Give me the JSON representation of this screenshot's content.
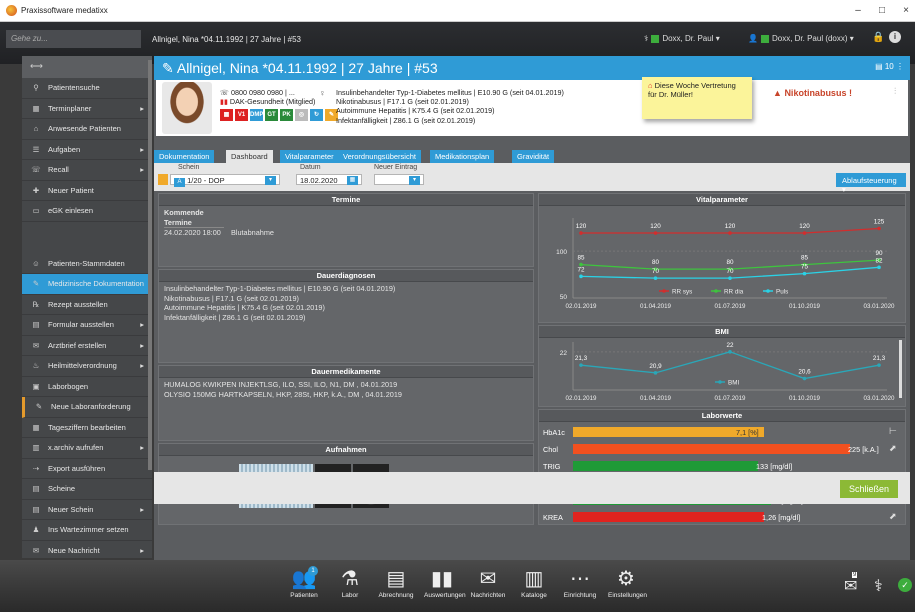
{
  "window": {
    "title": "Praxissoftware medatixx",
    "min": "–",
    "max": "□",
    "close": "×"
  },
  "topbar": {
    "search_placeholder": "Gehe zu...",
    "patient": "Allnigel, Nina *04.11.1992 | 27 Jahre | #53",
    "doctor1": "Doxx, Dr. Paul",
    "doctor2": "Doxx, Dr. Paul (doxx)"
  },
  "sidebar": {
    "items": [
      {
        "label": "Patientensuche",
        "icon": "search-user-icon",
        "arrow": false
      },
      {
        "label": "Terminplaner",
        "icon": "calendar-icon",
        "arrow": true
      },
      {
        "label": "Anwesende Patienten",
        "icon": "building-icon",
        "arrow": false
      },
      {
        "label": "Aufgaben",
        "icon": "checklist-icon",
        "arrow": true
      },
      {
        "label": "Recall",
        "icon": "recall-icon",
        "arrow": true
      },
      {
        "label": "Neuer Patient",
        "icon": "add-user-icon",
        "arrow": false
      },
      {
        "label": "eGK einlesen",
        "icon": "card-icon",
        "arrow": false
      },
      {
        "label": "Patienten-Stammdaten",
        "icon": "user-icon",
        "arrow": false
      },
      {
        "label": "Medizinische Dokumentation",
        "icon": "doc-edit-icon",
        "arrow": false
      },
      {
        "label": "Rezept ausstellen",
        "icon": "prescription-icon",
        "arrow": false
      },
      {
        "label": "Formular ausstellen",
        "icon": "form-icon",
        "arrow": true
      },
      {
        "label": "Arztbrief erstellen",
        "icon": "letter-icon",
        "arrow": true
      },
      {
        "label": "Heilmittelverordnung",
        "icon": "therapy-icon",
        "arrow": true
      },
      {
        "label": "Laborbogen",
        "icon": "lab-sheet-icon",
        "arrow": false
      },
      {
        "label": "Neue Laboranforderung",
        "icon": "lab-request-icon",
        "arrow": false
      },
      {
        "label": "Tagesziffern bearbeiten",
        "icon": "calendar-edit-icon",
        "arrow": false
      },
      {
        "label": "x.archiv aufrufen",
        "icon": "archive-icon",
        "arrow": true
      },
      {
        "label": "Export ausführen",
        "icon": "export-icon",
        "arrow": false
      },
      {
        "label": "Scheine",
        "icon": "scheine-icon",
        "arrow": false
      },
      {
        "label": "Neuer Schein",
        "icon": "new-schein-icon",
        "arrow": true
      },
      {
        "label": "Ins Wartezimmer setzen",
        "icon": "waiting-room-icon",
        "arrow": false
      },
      {
        "label": "Neue Nachricht",
        "icon": "message-icon",
        "arrow": true
      }
    ]
  },
  "header": {
    "title": "Allnigel, Nina *04.11.1992 | 27 Jahre | #53",
    "right_badge": "10"
  },
  "patient": {
    "phone": "0800 0980 0980 | ...",
    "insurance": "DAK-Gesundheit (Mitglied)",
    "badges": [
      "V1",
      "DMP",
      "GT",
      "PK"
    ],
    "diagnoses": [
      "Insulinbehandelter Typ-1-Diabetes mellitus | E10.90 G (seit 04.01.2019)",
      "Nikotinabusus | F17.1 G (seit 02.01.2019)",
      "Autoimmune Hepatitis | K75.4 G (seit 02.01.2019)",
      "Infektanfälligkeit | Z86.1 G (seit 02.01.2019)"
    ],
    "note": "Diese Woche Vertretung für Dr. Müller!",
    "alert": "Nikotinabusus !"
  },
  "tabs": [
    "Dokumentation",
    "Dashboard",
    "Vitalparameter",
    "Verordnungsübersicht",
    "Medikationsplan",
    "Gravidität"
  ],
  "active_tab": "Dashboard",
  "filters": {
    "schein_label": "Schein",
    "schein_value": "1/20 - DOP",
    "datum_label": "Datum",
    "datum_value": "18.02.2020",
    "eintrag_label": "Neuer Eintrag",
    "ablauf_label": "Ablaufsteuerung"
  },
  "termine": {
    "title": "Termine",
    "sub": "Kommende Termine",
    "date": "24.02.2020 18:00",
    "desc": "Blutabnahme"
  },
  "dauerdiagnosen": {
    "title": "Dauerdiagnosen",
    "lines": [
      "Insulinbehandelter Typ-1-Diabetes mellitus | E10.90 G (seit 04.01.2019)",
      "Nikotinabusus | F17.1 G (seit 02.01.2019)",
      "Autoimmune Hepatitis | K75.4 G (seit 02.01.2019)",
      "Infektanfälligkeit | Z86.1 G (seit 02.01.2019)"
    ]
  },
  "dauermedikamente": {
    "title": "Dauermedikamente",
    "lines": [
      "HUMALOG KWIKPEN INJEKTLSG, ILO, SSI, ILO, N1, DM , 04.01.2019",
      "OLYSIO 150MG HARTKAPSELN, HKP, 28St, HKP, k.A., DM , 04.01.2019"
    ]
  },
  "aufnahmen": {
    "title": "Aufnahmen"
  },
  "chart_data": [
    {
      "type": "line",
      "title": "Vitalparameter",
      "categories": [
        "02.01.2019",
        "01.04.2019",
        "01.07.2019",
        "01.10.2019",
        "03.01.2020"
      ],
      "ytick_labels": [
        "100",
        "50"
      ],
      "series": [
        {
          "name": "RR sys",
          "color": "#d22d2d",
          "values": [
            120,
            120,
            120,
            120,
            125
          ]
        },
        {
          "name": "RR dia",
          "color": "#3ec43e",
          "values": [
            85,
            80,
            80,
            85,
            90
          ]
        },
        {
          "name": "Puls",
          "color": "#2ad2e6",
          "values": [
            72,
            70,
            70,
            75,
            82
          ]
        }
      ]
    },
    {
      "type": "line",
      "title": "BMI",
      "categories": [
        "02.01.2019",
        "01.04.2019",
        "01.07.2019",
        "01.10.2019",
        "03.01.2020"
      ],
      "ytick_labels": [
        "22"
      ],
      "series": [
        {
          "name": "BMI",
          "color": "#2aa7b8",
          "values": [
            21.3,
            20.9,
            22,
            20.6,
            21.3
          ]
        }
      ]
    },
    {
      "type": "bar",
      "title": "Laborwerte",
      "categories": [
        "HbA1c",
        "Chol",
        "TRIG",
        "GPT",
        "HRSE",
        "KREA"
      ],
      "labels": [
        "7,1 [%]",
        "225 [k.A.]",
        "133 [mg/dl]",
        "45 [k.A.]",
        "6,0 [mg/dl]",
        "1,26 [mg/dl]"
      ],
      "fractions": [
        0.58,
        0.84,
        0.56,
        0.45,
        0.6,
        0.58
      ],
      "colors": [
        "#f0a92a",
        "#f2501f",
        "#1f9a37",
        "#a8d8ea",
        "#1f9a37",
        "#e0231f"
      ],
      "trend_icons": [
        "⊢",
        "⬈",
        "",
        "⬈",
        "▷",
        "⬈"
      ]
    }
  ],
  "footer": {
    "close_label": "Schließen"
  },
  "dock": [
    "Patienten",
    "Labor",
    "Abrechnung",
    "Auswertungen",
    "Nachrichten",
    "Kataloge",
    "Einrichtung",
    "Einstellungen"
  ],
  "dock_badge": "1",
  "tray_badge": "9"
}
